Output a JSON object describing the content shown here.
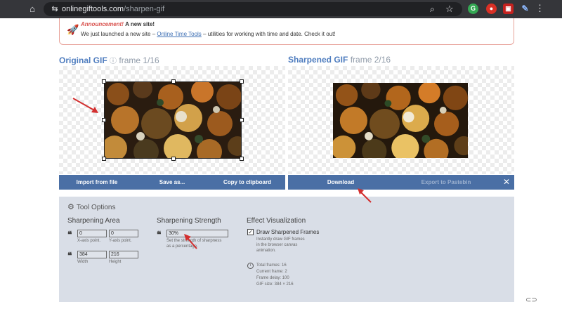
{
  "browser": {
    "url_domain": "onlinegiftools.com",
    "url_path": "/sharpen-gif",
    "extension_g": "G"
  },
  "announcement": {
    "heading_highlight": "Announcement!",
    "heading_rest": "A new site!",
    "text_before": "We just launched a new site – ",
    "link": "Online Time Tools",
    "text_after": " – utilities for working with time and date. Check it out!"
  },
  "left_panel": {
    "title": "Original GIF",
    "frame": "frame 1/16",
    "buttons": [
      "Import from file",
      "Save as...",
      "Copy to clipboard"
    ]
  },
  "right_panel": {
    "title": "Sharpened GIF",
    "frame": "frame 2/16",
    "buttons": [
      "Download",
      "Export to Pastebin"
    ]
  },
  "tool_options": {
    "title": "Tool Options",
    "area": {
      "title": "Sharpening Area",
      "x_value": "0",
      "y_value": "0",
      "x_hint": "X-axis point.",
      "y_hint": "Y-axis point.",
      "width_value": "384",
      "height_value": "216",
      "width_hint": "Width",
      "height_hint": "Height"
    },
    "strength": {
      "title": "Sharpening Strength",
      "value": "30%",
      "hint_line1": "Set the strength of sharpness",
      "hint_line2": "as a percentage."
    },
    "effect": {
      "title": "Effect Visualization",
      "checkbox_label": "Draw Sharpened Frames",
      "checkbox_checked": true,
      "hint_line1": "Instantly draw GIF frames",
      "hint_line2": "in the browser canvas",
      "hint_line3": "animation.",
      "total_frames": "Total frames: 16",
      "current_frame": "Current frame: 2",
      "frame_delay": "Frame delay: 100",
      "gif_size": "GIF size: 384 × 216"
    }
  },
  "colors": {
    "accent": "#4f7dbf",
    "toolbar": "#4a6fa5",
    "options_bg": "#d9dee7",
    "annotation_arrow": "#d32f2f"
  }
}
